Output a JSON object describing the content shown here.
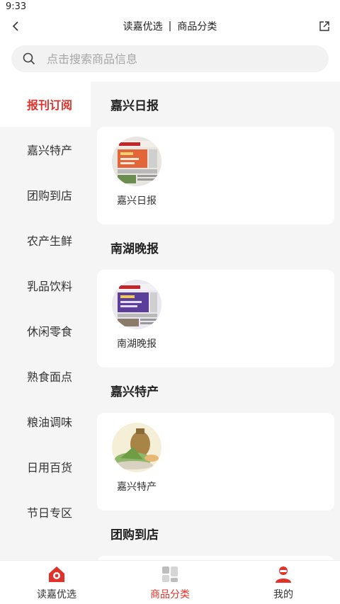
{
  "status": {
    "time": "9:33"
  },
  "nav": {
    "title_left": "读嘉优选",
    "title_sep": "|",
    "title_right": "商品分类"
  },
  "search": {
    "placeholder": "点击搜索商品信息"
  },
  "sidebar": {
    "items": [
      {
        "label": "报刊订阅",
        "active": true
      },
      {
        "label": "嘉兴特产"
      },
      {
        "label": "团购到店"
      },
      {
        "label": "农产生鲜"
      },
      {
        "label": "乳品饮料"
      },
      {
        "label": "休闲零食"
      },
      {
        "label": "熟食面点"
      },
      {
        "label": "粮油调味"
      },
      {
        "label": "日用百货"
      },
      {
        "label": "节日专区"
      }
    ]
  },
  "sections": [
    {
      "title": "嘉兴日报",
      "item": {
        "label": "嘉兴日报",
        "icon": "newspaper-thumb"
      }
    },
    {
      "title": "南湖晚报",
      "item": {
        "label": "南湖晚报",
        "icon": "newspaper-thumb"
      }
    },
    {
      "title": "嘉兴特产",
      "item": {
        "label": "嘉兴特产",
        "icon": "zongzi-thumb"
      }
    },
    {
      "title": "团购到店"
    }
  ],
  "tabbar": {
    "tabs": [
      {
        "label": "读嘉优选",
        "icon": "home-icon"
      },
      {
        "label": "商品分类",
        "icon": "category-icon",
        "active": true
      },
      {
        "label": "我的",
        "icon": "user-icon"
      }
    ]
  },
  "colors": {
    "accent": "#e0312a",
    "background": "#f5f5f5"
  }
}
